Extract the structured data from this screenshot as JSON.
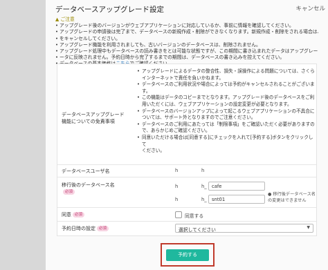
{
  "modal": {
    "title": "データベースアップグレード設定",
    "cancel": "キャンセル"
  },
  "notice": {
    "heading": "ご注意",
    "items": [
      "アップグレード後のバージョンがウェブアプリケーションに対応しているか、事前に情報を確認してください。",
      "アップグレードの申請後は完了まで、データベースの新規作成・削除ができなくなります。新規作成・削除をされる場合は、申請",
      "をキャンセルしてください。",
      "アップグレード機能を利用されましても、古いバージョンのデータベースは、削除されません。",
      "アップグレード処理中もデータベースの読み書きをとは可能な状態ですが、この期間に書き込まれたデータはアップグレード後のデ",
      "ータに反映されません。予約日時から完了するまでの期間は、データベースの書き込みを控えてください。"
    ],
    "last_prefix": "データベースの基本価格は",
    "last_link": "こちら",
    "last_suffix": "でご確認ください。"
  },
  "disclaimer": {
    "label_line1": "データベースアップグレード",
    "label_line2": "機能についての免責事項",
    "items": [
      "アップグレードによるデータの整合性、損失・誤操作による問題については、さくら",
      "インターネットで責任を負いかねます。",
      "データベースのご利用状況や場合によっては予約がキャンセルされることがございま",
      "す。",
      "この機能はデータのコピーまでとなります。アップグレード後のデータベースをご利",
      "用いただくには、ウェブアプリケーションの設定変更が必要となります。",
      "データベースのバージョンアップによって起こるウェブアプリケーションの不具合に",
      "ついては、サポート外となりますのでご注意ください。",
      "データベースのご利用にあたっては「制限事項」をご確認いただく必要がありますの",
      "で、あらかじめご確認ください。",
      "同意いただける場合は[同意する]にチェックを入れて[予約する]ボタンをクリックして",
      "ください。"
    ]
  },
  "fields": {
    "db_user_label": "データベースユーザ名",
    "db_user_value": "h",
    "db_user_value2": "h",
    "target_name_label": "移行後のデータベース名",
    "required": "必須",
    "target_prefix1": "h",
    "target_prefix2": "h",
    "target_sep": "h_",
    "target_input1": "cafe",
    "target_input2": "snt01",
    "target_note": "移行後データベース名の変更はできません",
    "agree_label": "同意",
    "agree_text": "同意する",
    "schedule_label": "予約日時の設定",
    "schedule_placeholder": "選択してください"
  },
  "submit": "予約する"
}
